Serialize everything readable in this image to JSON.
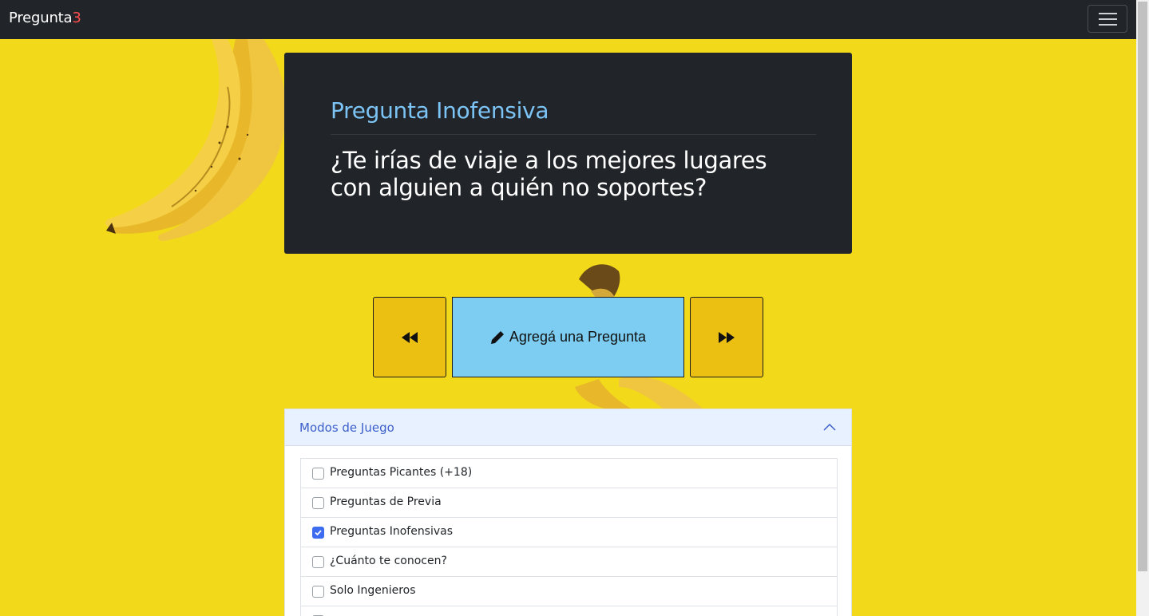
{
  "app": {
    "brand_main": "Pregunta",
    "brand_accent": "3"
  },
  "question": {
    "category": "Pregunta Inofensiva",
    "text": "¿Te irías de viaje a los mejores lugares con alguien a quién no soportes?"
  },
  "controls": {
    "prev_icon": "backward-icon",
    "next_icon": "forward-icon",
    "add_icon": "pencil-icon",
    "add_label": "Agregá una Pregunta"
  },
  "game_modes": {
    "title": "Modos de Juego",
    "expanded": true,
    "items": [
      {
        "label": "Preguntas Picantes (+18)",
        "checked": false
      },
      {
        "label": "Preguntas de Previa",
        "checked": false
      },
      {
        "label": "Preguntas Inofensivas",
        "checked": true
      },
      {
        "label": "¿Cuánto te conocen?",
        "checked": false
      },
      {
        "label": "Solo Ingenieros",
        "checked": false
      }
    ]
  },
  "colors": {
    "background": "#f2d91a",
    "navbar": "#212529",
    "card": "#212529",
    "category_text": "#7cc4f5",
    "nav_button": "#ecc013",
    "add_button": "#7ccdf1",
    "brand_accent": "#ff4d4d",
    "checkbox_checked": "#3d6cf0"
  }
}
